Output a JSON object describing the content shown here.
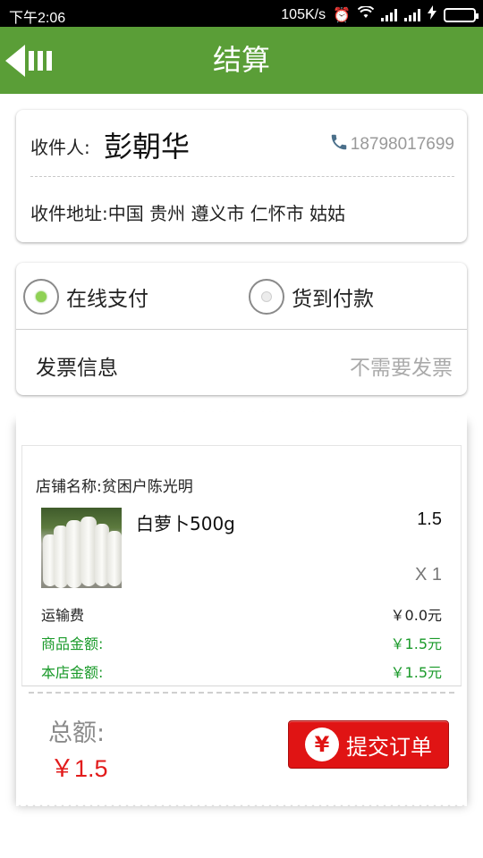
{
  "status_bar": {
    "time": "下午2:06",
    "speed": "105K/s",
    "icons": [
      "alarm-icon",
      "wifi-icon",
      "signal-icon",
      "signal-icon",
      "charging-icon",
      "battery-icon"
    ],
    "battery_color": "#5bc236"
  },
  "header": {
    "title": "结算",
    "back_icon": "back-menu-icon",
    "bg_color": "#5a9e37"
  },
  "address": {
    "recipient_label": "收件人:",
    "recipient_name": "彭朝华",
    "phone": "18798017699",
    "phone_icon": "phone-icon",
    "address_text": "收件地址:中国 贵州 遵义市 仁怀市 姑姑"
  },
  "payment": {
    "options": [
      {
        "label": "在线支付",
        "selected": true
      },
      {
        "label": "货到付款",
        "selected": false
      }
    ],
    "invoice_label": "发票信息",
    "invoice_value": "不需要发票"
  },
  "order": {
    "shop_name": "店铺名称:贫困户陈光明",
    "item": {
      "name": "白萝卜500g",
      "price": "1.5",
      "quantity": "X 1",
      "image": "radish-image"
    },
    "shipping_label": "运输费",
    "shipping_value": "￥0.0元",
    "goods_amount_label": "商品金额:",
    "goods_amount_value": "￥1.5元",
    "shop_amount_label": "本店金额:",
    "shop_amount_value": "￥1.5元",
    "green_color": "#1a9a2a"
  },
  "footer": {
    "total_label": "总额:",
    "total_value": "￥1.5",
    "submit_label": "提交订单",
    "submit_icon": "yen-icon",
    "submit_color": "#e01414"
  }
}
